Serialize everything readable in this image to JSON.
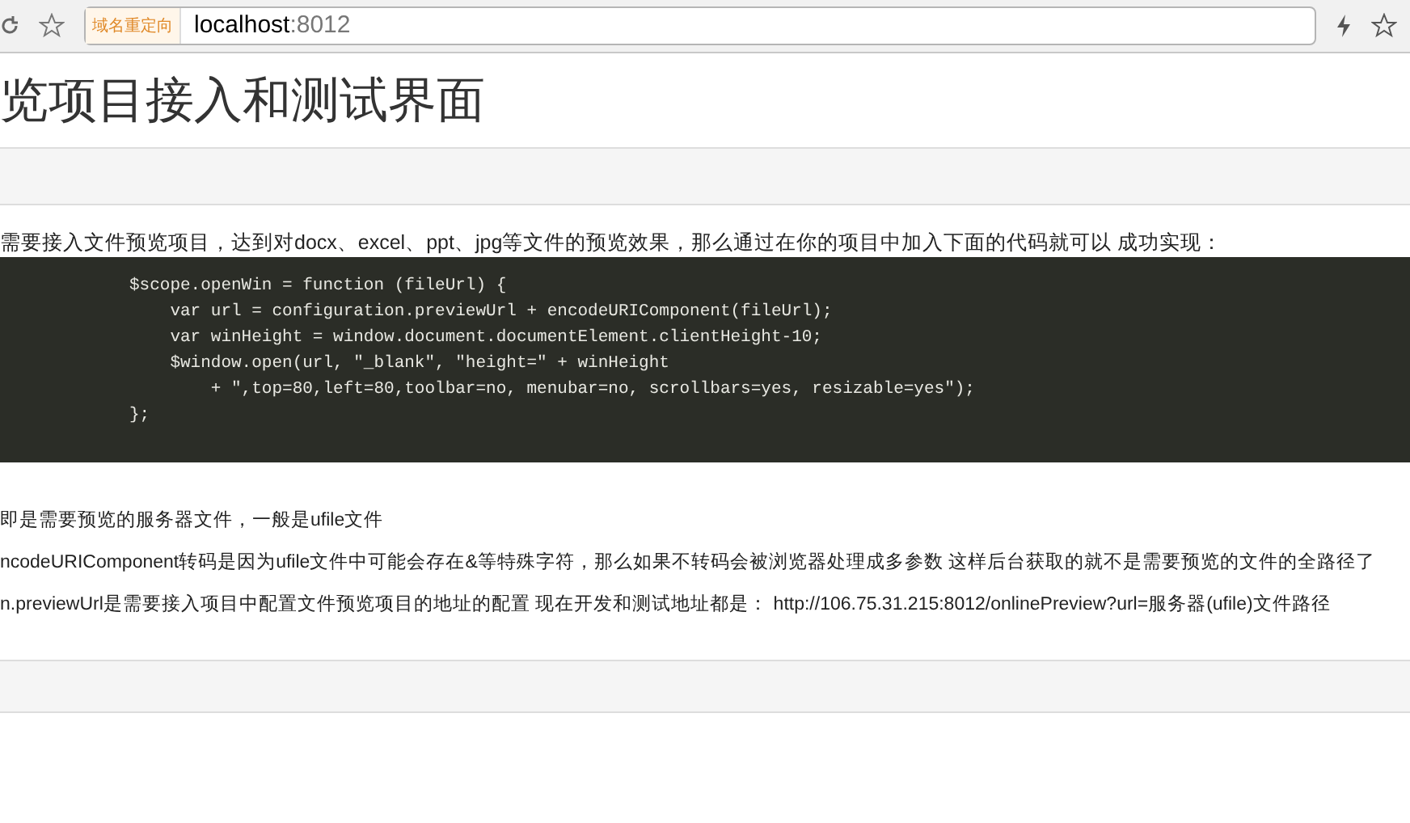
{
  "browser": {
    "redirect_badge": "域名重定向",
    "url_host": "localhost",
    "url_port": ":8012"
  },
  "page_title": "览项目接入和测试界面",
  "intro": "需要接入文件预览项目，达到对docx、excel、ppt、jpg等文件的预览效果，那么通过在你的项目中加入下面的代码就可以 成功实现：",
  "code_lines": [
    "$scope.openWin = function (fileUrl) {",
    "    var url = configuration.previewUrl + encodeURIComponent(fileUrl);",
    "    var winHeight = window.document.documentElement.clientHeight-10;",
    "    $window.open(url, \"_blank\", \"height=\" + winHeight",
    "        + \",top=80,left=80,toolbar=no, menubar=no, scrollbars=yes, resizable=yes\");",
    "};"
  ],
  "notes": [
    "即是需要预览的服务器文件，一般是ufile文件",
    "ncodeURIComponent转码是因为ufile文件中可能会存在&等特殊字符，那么如果不转码会被浏览器处理成多参数 这样后台获取的就不是需要预览的文件的全路径了",
    "n.previewUrl是需要接入项目中配置文件预览项目的地址的配置 现在开发和测试地址都是：  http://106.75.31.215:8012/onlinePreview?url=服务器(ufile)文件路径"
  ]
}
